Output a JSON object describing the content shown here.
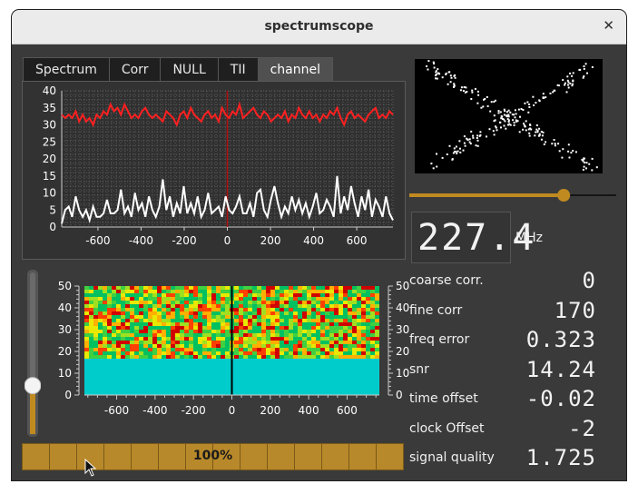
{
  "window": {
    "title": "spectrumscope",
    "close_glyph": "✕"
  },
  "tabs": [
    {
      "label": "Spectrum",
      "active": false
    },
    {
      "label": "Corr",
      "active": false
    },
    {
      "label": "NULL",
      "active": false
    },
    {
      "label": "TII",
      "active": false
    },
    {
      "label": "channel",
      "active": true
    }
  ],
  "chart_data": [
    {
      "type": "line",
      "x_ticks": [
        "-600",
        "-400",
        "-200",
        "0",
        "200",
        "400",
        "600"
      ],
      "y_ticks": [
        "0",
        "5",
        "10",
        "15",
        "20",
        "25",
        "30",
        "35",
        "40"
      ],
      "xlim": [
        -768,
        768
      ],
      "ylim": [
        0,
        40
      ],
      "grid": true,
      "marker_x": 0,
      "series": [
        {
          "color": "#ff2020",
          "values": [
            33,
            32,
            33,
            32,
            34,
            31,
            33,
            31,
            32,
            30,
            33,
            32,
            34,
            33,
            36,
            34,
            35,
            33,
            36,
            34,
            32,
            33,
            32,
            34,
            35,
            33,
            32,
            33,
            32,
            31,
            34,
            33,
            32,
            30,
            33,
            34,
            32,
            35,
            33,
            32,
            31,
            33,
            34,
            32,
            33,
            31,
            35,
            33,
            32,
            34,
            33,
            36,
            32,
            33,
            34,
            35,
            33,
            32,
            34,
            33,
            31,
            32,
            33,
            32,
            34,
            31,
            33,
            32,
            35,
            33,
            32,
            34,
            32,
            33,
            31,
            33,
            32,
            34,
            33,
            35,
            32,
            30,
            33,
            34,
            32,
            33,
            32,
            31,
            33,
            34,
            35,
            32,
            33,
            32,
            34,
            33
          ]
        },
        {
          "color": "#ffffff",
          "values": [
            1,
            5,
            6,
            3,
            9,
            5,
            3,
            5,
            2,
            6,
            3,
            3,
            4,
            8,
            4,
            4,
            5,
            11,
            4,
            6,
            3,
            10,
            5,
            7,
            3,
            9,
            5,
            3,
            6,
            14,
            5,
            9,
            3,
            7,
            4,
            12,
            4,
            7,
            4,
            9,
            3,
            5,
            10,
            4,
            5,
            6,
            3,
            9,
            5,
            4,
            6,
            9,
            4,
            4,
            7,
            3,
            10,
            11,
            5,
            3,
            8,
            12,
            7,
            3,
            6,
            4,
            9,
            5,
            8,
            4,
            7,
            3,
            6,
            10,
            4,
            5,
            8,
            6,
            3,
            15,
            4,
            9,
            5,
            12,
            7,
            3,
            9,
            5,
            11,
            3,
            8,
            6,
            3,
            9,
            4,
            2
          ]
        }
      ]
    },
    {
      "type": "heatmap",
      "x_ticks": [
        "-600",
        "-400",
        "-200",
        "0",
        "200",
        "400",
        "600"
      ],
      "y_ticks": [
        "0",
        "10",
        "20",
        "30",
        "40",
        "50"
      ],
      "xlim": [
        -768,
        768
      ],
      "ylim": [
        0,
        50
      ],
      "filled_rows_from": 18,
      "base_color": "#00cccc",
      "palette": [
        "#00c060",
        "#40d040",
        "#a0e020",
        "#e8e800",
        "#ffb000",
        "#ff4000",
        "#d00000"
      ],
      "marker_x": 0
    }
  ],
  "scope": {
    "icon": "iq-constellation",
    "bg": "#000000"
  },
  "frequency": {
    "value": "227.4",
    "unit": "MHz"
  },
  "hslider_level": 0.76,
  "vslider_level": 0.1,
  "readouts": [
    {
      "label": "coarse corr.",
      "value": "0"
    },
    {
      "label": "fine corr",
      "value": "170"
    },
    {
      "label": "freq error",
      "value": "0.323"
    },
    {
      "label": "snr",
      "value": "14.24"
    },
    {
      "label": "time offset",
      "value": "-0.02"
    },
    {
      "label": "clock Offset",
      "value": "-2"
    },
    {
      "label": "signal quality",
      "value": "1.725"
    }
  ],
  "quality_bar": {
    "label": "100%",
    "percent": 100,
    "color": "#b8892a"
  },
  "accent": "#c08a20"
}
